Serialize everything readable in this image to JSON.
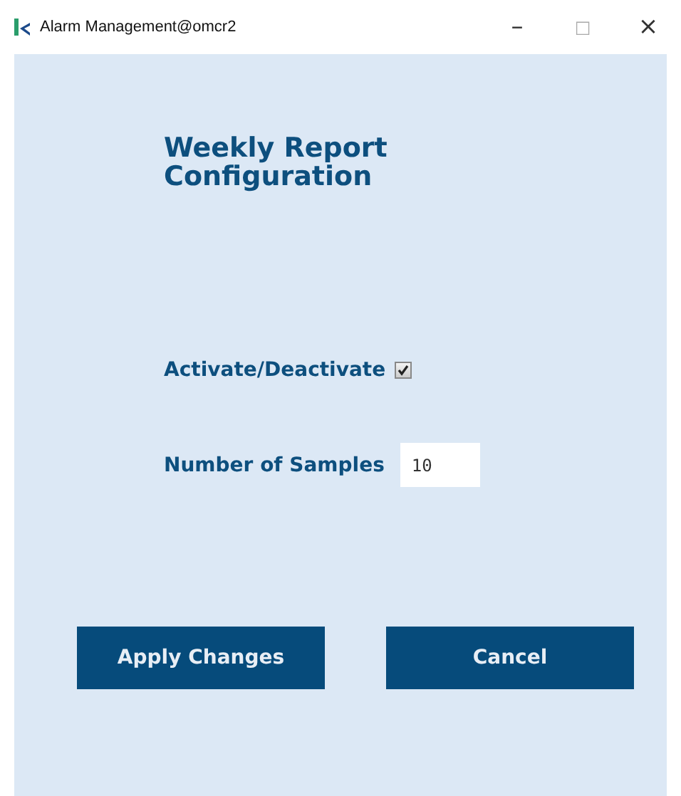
{
  "window": {
    "title": "Alarm Management@omcr2",
    "controls": [
      "–",
      "□",
      "×"
    ]
  },
  "heading": "Weekly Report Configuration",
  "activate": {
    "label": "Activate/Deactivate",
    "checked": true
  },
  "samples": {
    "label": "Number of Samples",
    "value": "10"
  },
  "buttons": [
    "Apply Changes",
    "Cancel"
  ]
}
